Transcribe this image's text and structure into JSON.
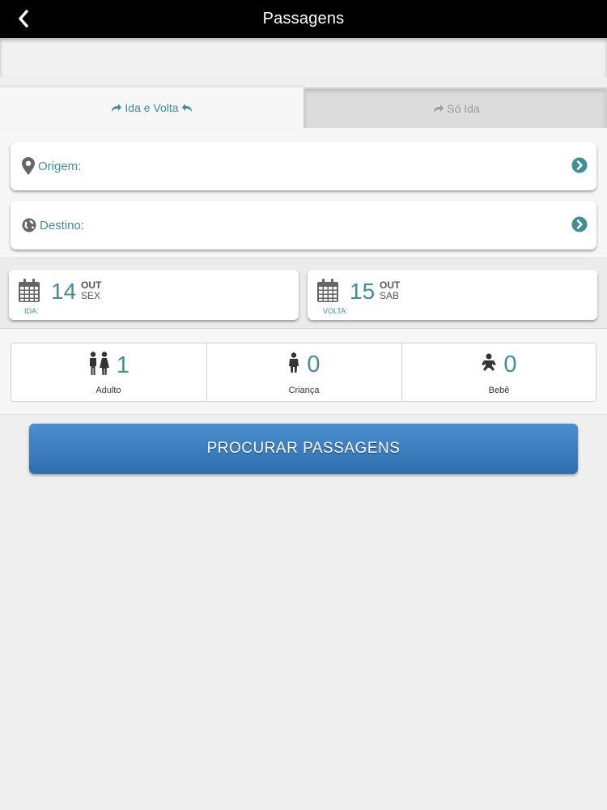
{
  "header": {
    "title": "Passagens",
    "back_icon": "chevron-left-icon"
  },
  "tabs": [
    {
      "label": "Ida e Volta",
      "active": true,
      "icons": [
        "share-forward-icon",
        "reply-icon"
      ]
    },
    {
      "label": "Só Ida",
      "active": false,
      "icons": [
        "share-forward-icon"
      ]
    }
  ],
  "form": {
    "origin": {
      "label": "Origem:",
      "value": "",
      "icon": "map-marker-icon",
      "action_icon": "chevron-circle-right-icon"
    },
    "destination": {
      "label": "Destino:",
      "value": "",
      "icon": "globe-icon",
      "action_icon": "chevron-circle-right-icon"
    }
  },
  "dates": {
    "departure": {
      "day": "14",
      "month": "OUT",
      "weekday": "SEX",
      "tag": "IDA:"
    },
    "return": {
      "day": "15",
      "month": "OUT",
      "weekday": "SAB",
      "tag": "VOLTA:"
    }
  },
  "passengers": [
    {
      "count": "1",
      "label": "Adulto",
      "icon": "adult-couple-icon"
    },
    {
      "count": "0",
      "label": "Criança",
      "icon": "child-icon"
    },
    {
      "count": "0",
      "label": "Bebê",
      "icon": "baby-icon"
    }
  ],
  "search_button": "PROCURAR PASSAGENS",
  "colors": {
    "accent": "#3f8f95",
    "button": "#3b7ec0",
    "topbar": "#000000"
  }
}
